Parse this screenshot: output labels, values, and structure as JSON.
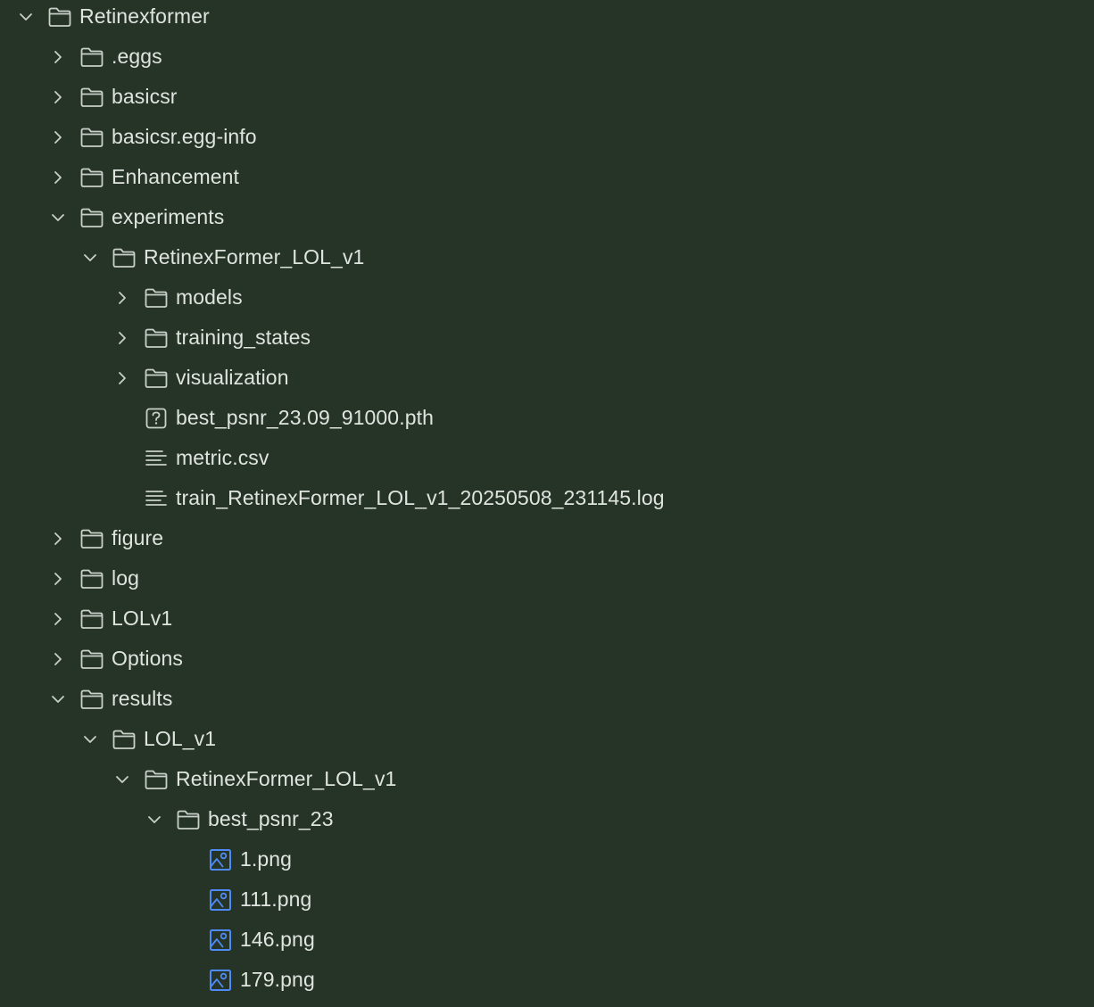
{
  "colors": {
    "background": "#263427",
    "text": "#dfe4df",
    "icon": "#c9d0c9",
    "image_icon": "#4f8bf7"
  },
  "tree": [
    {
      "label": "Retinexformer",
      "depth": 0,
      "type": "folder",
      "expanded": true,
      "icon": "folder-icon"
    },
    {
      "label": ".eggs",
      "depth": 1,
      "type": "folder",
      "expanded": false,
      "icon": "folder-icon"
    },
    {
      "label": "basicsr",
      "depth": 1,
      "type": "folder",
      "expanded": false,
      "icon": "folder-icon"
    },
    {
      "label": "basicsr.egg-info",
      "depth": 1,
      "type": "folder",
      "expanded": false,
      "icon": "folder-icon"
    },
    {
      "label": "Enhancement",
      "depth": 1,
      "type": "folder",
      "expanded": false,
      "icon": "folder-icon"
    },
    {
      "label": "experiments",
      "depth": 1,
      "type": "folder",
      "expanded": true,
      "icon": "folder-icon"
    },
    {
      "label": "RetinexFormer_LOL_v1",
      "depth": 2,
      "type": "folder",
      "expanded": true,
      "icon": "folder-icon"
    },
    {
      "label": "models",
      "depth": 3,
      "type": "folder",
      "expanded": false,
      "icon": "folder-icon"
    },
    {
      "label": "training_states",
      "depth": 3,
      "type": "folder",
      "expanded": false,
      "icon": "folder-icon"
    },
    {
      "label": "visualization",
      "depth": 3,
      "type": "folder",
      "expanded": false,
      "icon": "folder-icon"
    },
    {
      "label": "best_psnr_23.09_91000.pth",
      "depth": 3,
      "type": "file",
      "icon": "unknown-file-icon"
    },
    {
      "label": "metric.csv",
      "depth": 3,
      "type": "file",
      "icon": "text-file-icon"
    },
    {
      "label": "train_RetinexFormer_LOL_v1_20250508_231145.log",
      "depth": 3,
      "type": "file",
      "icon": "text-file-icon"
    },
    {
      "label": "figure",
      "depth": 1,
      "type": "folder",
      "expanded": false,
      "icon": "folder-icon"
    },
    {
      "label": "log",
      "depth": 1,
      "type": "folder",
      "expanded": false,
      "icon": "folder-icon"
    },
    {
      "label": "LOLv1",
      "depth": 1,
      "type": "folder",
      "expanded": false,
      "icon": "folder-icon"
    },
    {
      "label": "Options",
      "depth": 1,
      "type": "folder",
      "expanded": false,
      "icon": "folder-icon"
    },
    {
      "label": "results",
      "depth": 1,
      "type": "folder",
      "expanded": true,
      "icon": "folder-icon"
    },
    {
      "label": "LOL_v1",
      "depth": 2,
      "type": "folder",
      "expanded": true,
      "icon": "folder-icon"
    },
    {
      "label": "RetinexFormer_LOL_v1",
      "depth": 3,
      "type": "folder",
      "expanded": true,
      "icon": "folder-icon"
    },
    {
      "label": "best_psnr_23",
      "depth": 4,
      "type": "folder",
      "expanded": true,
      "icon": "folder-icon"
    },
    {
      "label": "1.png",
      "depth": 5,
      "type": "file",
      "icon": "image-file-icon"
    },
    {
      "label": "111.png",
      "depth": 5,
      "type": "file",
      "icon": "image-file-icon"
    },
    {
      "label": "146.png",
      "depth": 5,
      "type": "file",
      "icon": "image-file-icon"
    },
    {
      "label": "179.png",
      "depth": 5,
      "type": "file",
      "icon": "image-file-icon"
    }
  ]
}
